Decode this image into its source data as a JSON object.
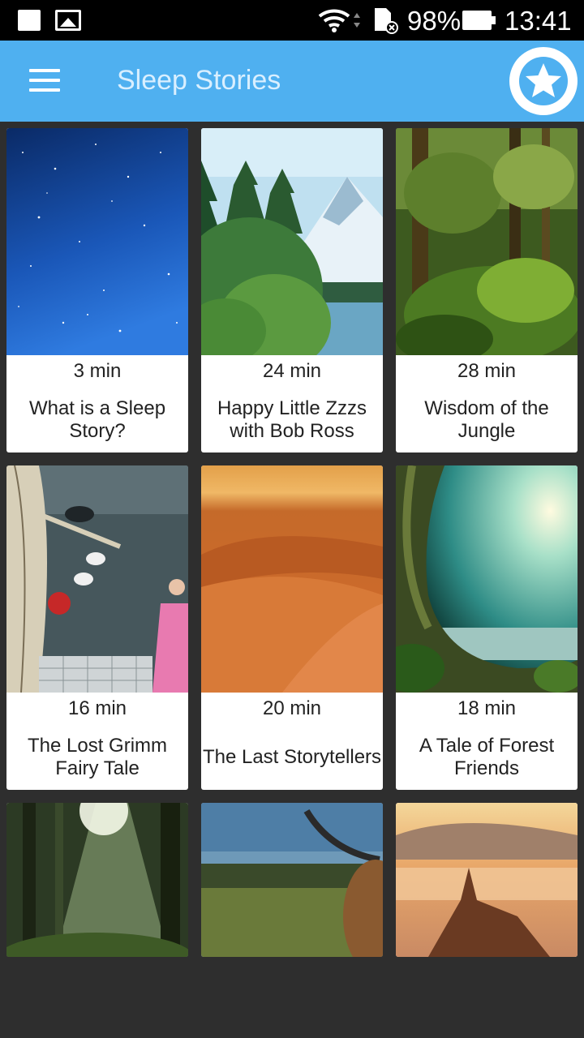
{
  "status_bar": {
    "battery_percent": "98%",
    "time": "13:41"
  },
  "app_bar": {
    "title": "Sleep Stories",
    "menu_icon": "hamburger-menu-icon",
    "favorite_icon": "star-icon",
    "color": "#4fb0f0"
  },
  "stories": [
    {
      "duration": "3 min",
      "title": "What is a Sleep Story?",
      "image": "starry-night-sky"
    },
    {
      "duration": "24 min",
      "title": "Happy Little Zzzs with Bob Ross",
      "image": "painted-mountain-lake"
    },
    {
      "duration": "28 min",
      "title": "Wisdom of the Jungle",
      "image": "jungle-forest"
    },
    {
      "duration": "16 min",
      "title": "The Lost Grimm Fairy Tale",
      "image": "fairy-tale-illustration"
    },
    {
      "duration": "20 min",
      "title": "The Last Storytellers",
      "image": "desert-dunes"
    },
    {
      "duration": "18 min",
      "title": "A Tale of Forest Friends",
      "image": "forest-archway-moon"
    },
    {
      "image": "sunlit-forest"
    },
    {
      "image": "highland-cattle"
    },
    {
      "image": "sandcastle-sunset"
    }
  ]
}
